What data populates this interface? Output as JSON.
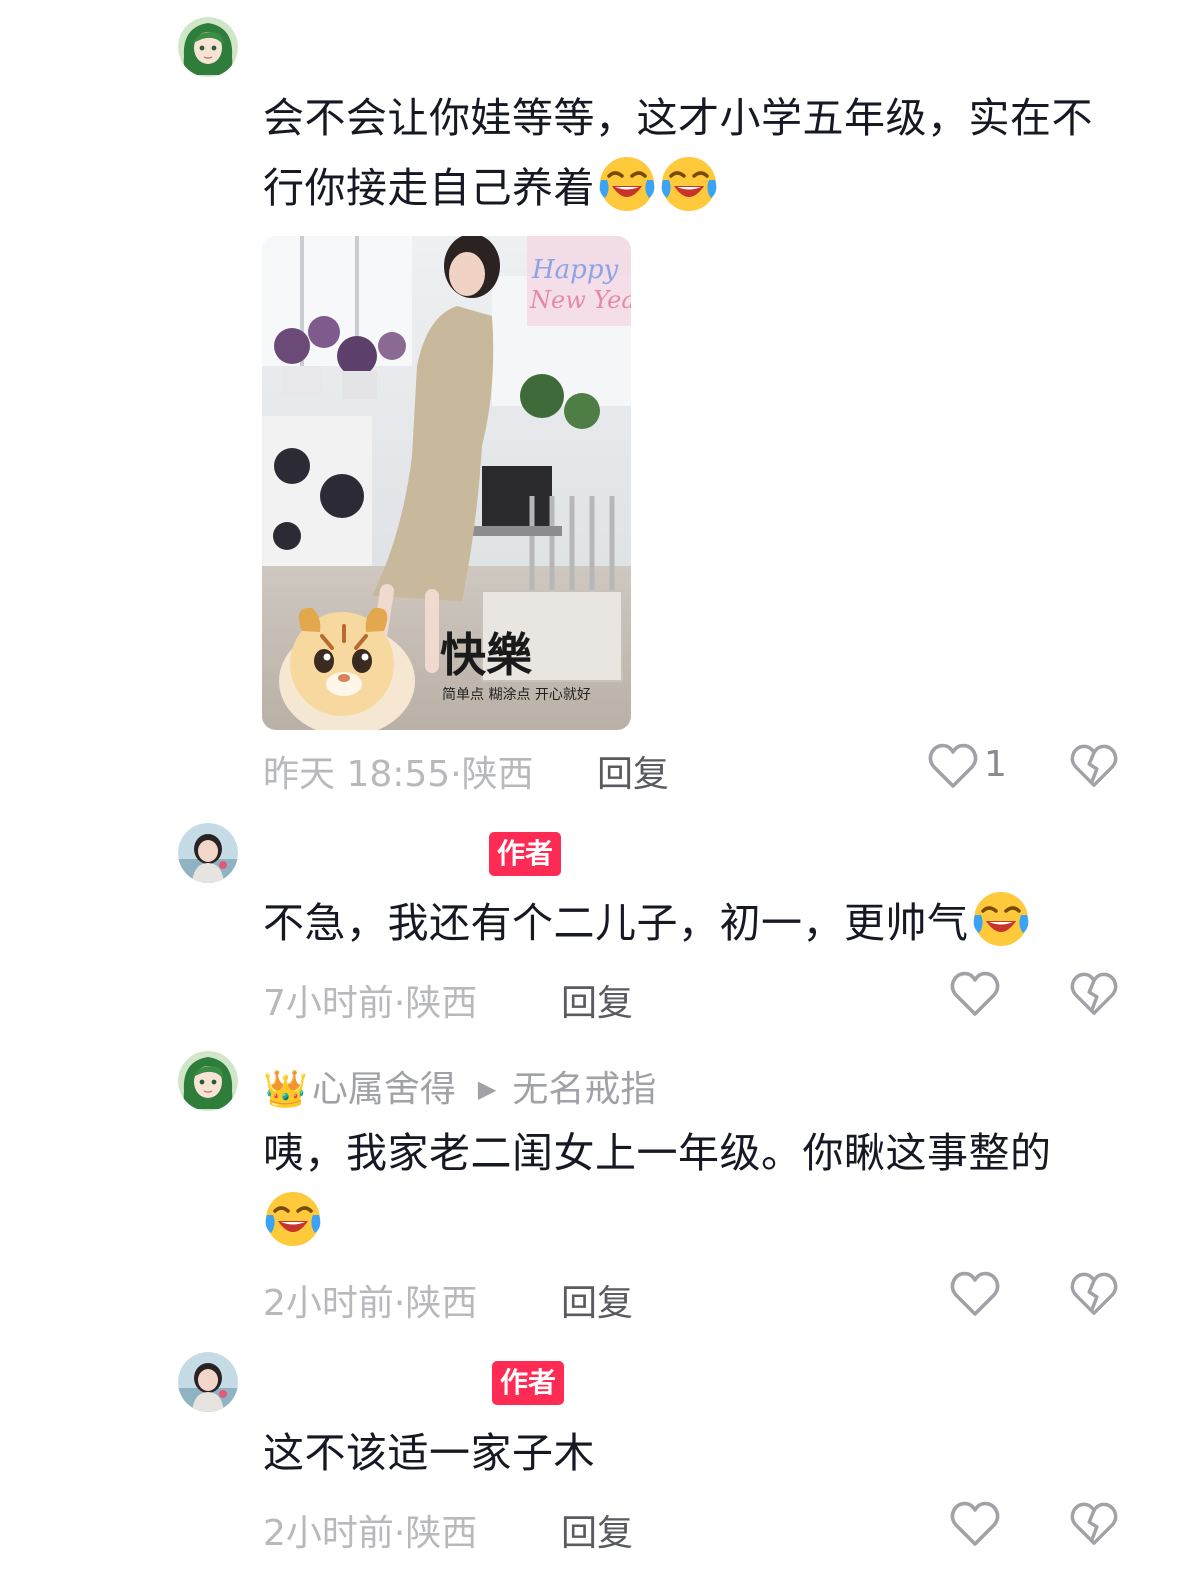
{
  "comments": [
    {
      "avatar": "green-hair-anime-girl-avatar",
      "text": "会不会让你娃等等，这才小学五年级，实在不行你接走自己养着",
      "emoji_count": 2,
      "emoji": "crying-laughing-emoji",
      "image": {
        "caption": "快樂",
        "subtitle": "简单点 糊涂点 开心就好",
        "banner_text": "Happy New Year"
      },
      "time": "昨天 18:55",
      "location": "陕西",
      "reply_label": "回复",
      "like_count": "1"
    },
    {
      "avatar": "woman-photo-avatar",
      "badge": "作者",
      "text": "不急，我还有个二儿子，初一，更帅气",
      "emoji_count": 1,
      "time": "7小时前",
      "location": "陕西",
      "reply_label": "回复"
    },
    {
      "avatar": "green-hair-anime-girl-avatar",
      "user_prefix": "👑",
      "user_name": "心属舍得",
      "reply_to": "无名戒指",
      "text": "咦，我家老二闺女上一年级。你瞅这事整的",
      "emoji_count": 1,
      "time": "2小时前",
      "location": "陕西",
      "reply_label": "回复"
    },
    {
      "avatar": "woman-photo-avatar",
      "badge": "作者",
      "text": "这不该适一家子木",
      "time": "2小时前",
      "location": "陕西",
      "reply_label": "回复"
    }
  ],
  "separator": "·",
  "colors": {
    "author_badge": "#fe2c55",
    "meta_text": "#b8b9bd",
    "body_text": "#161823"
  }
}
